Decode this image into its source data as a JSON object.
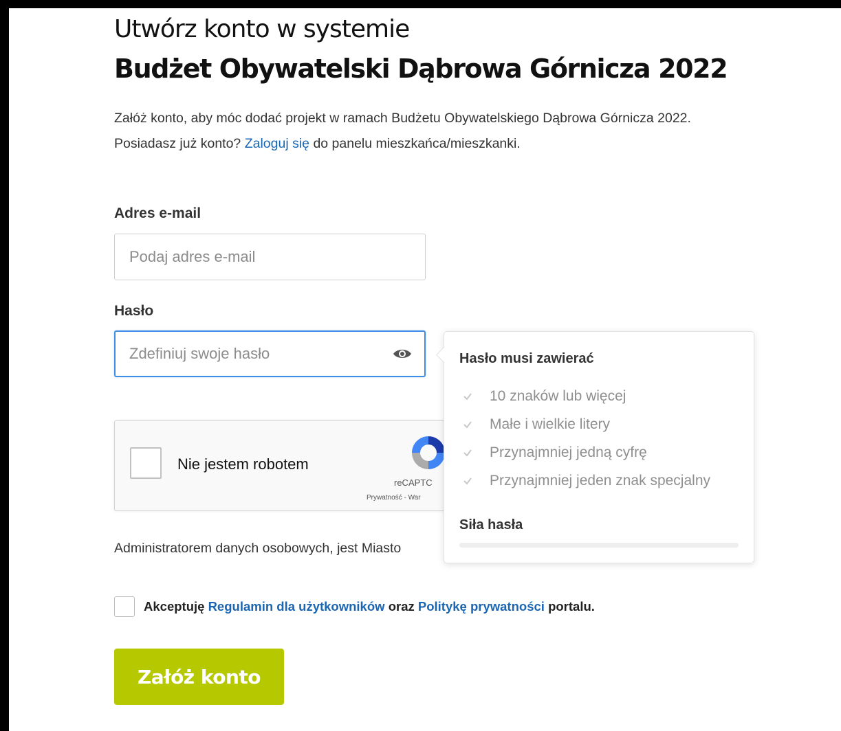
{
  "header": {
    "title_line1": "Utwórz konto w systemie",
    "title_line2": "Budżet Obywatelski Dąbrowa Górnicza 2022"
  },
  "intro": {
    "line1": "Załóż konto, aby móc dodać projekt w ramach Budżetu Obywatelskiego Dąbrowa Górnicza 2022.",
    "line2_prefix": "Posiadasz już konto?",
    "login_link": "Zaloguj się",
    "line2_suffix": "do panelu mieszkańca/mieszkanki."
  },
  "form": {
    "email": {
      "label": "Adres e-mail",
      "placeholder": "Podaj adres e-mail",
      "value": ""
    },
    "password": {
      "label": "Hasło",
      "placeholder": "Zdefiniuj swoje hasło",
      "value": "",
      "show_icon": "eye-icon"
    }
  },
  "password_popover": {
    "title": "Hasło musi zawierać",
    "requirements": [
      {
        "text": "10 znaków lub więcej",
        "met": false
      },
      {
        "text": "Małe i wielkie litery",
        "met": false
      },
      {
        "text": "Przynajmniej jedną cyfrę",
        "met": false
      },
      {
        "text": "Przynajmniej jeden znak specjalny",
        "met": false
      }
    ],
    "strength_label": "Siła hasła",
    "strength_level": 0
  },
  "recaptcha": {
    "label": "Nie jestem robotem",
    "brand": "reCAPTC",
    "links": "Prywatność - War"
  },
  "admin_text": "Administratorem danych osobowych, jest Miasto",
  "terms": {
    "prefix": "Akceptuję",
    "link1": "Regulamin dla użytkowników",
    "middle": "oraz",
    "link2": "Politykę prywatności",
    "suffix": "portalu."
  },
  "submit_label": "Załóż konto",
  "colors": {
    "accent": "#b5c800",
    "link": "#1a66b3",
    "focus_border": "#3f8ee6"
  }
}
